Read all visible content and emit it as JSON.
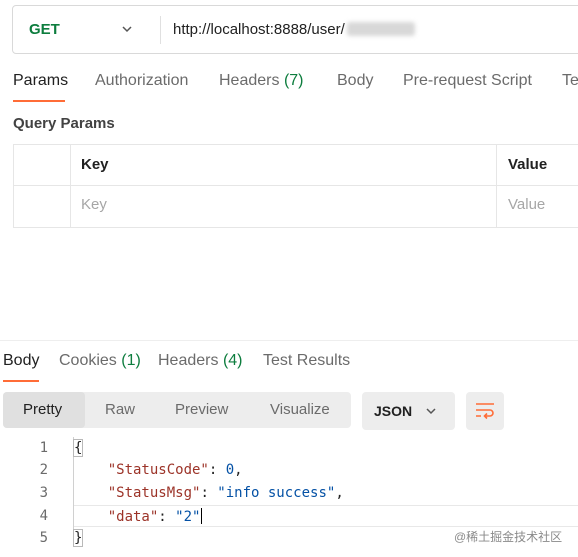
{
  "request": {
    "method": "GET",
    "url": "http://localhost:8888/user/"
  },
  "request_tabs": [
    {
      "label": "Params",
      "count": ""
    },
    {
      "label": "Authorization",
      "count": ""
    },
    {
      "label": "Headers",
      "count": "(7)"
    },
    {
      "label": "Body",
      "count": ""
    },
    {
      "label": "Pre-request Script",
      "count": ""
    },
    {
      "label": "Te",
      "count": ""
    }
  ],
  "query_params": {
    "title": "Query Params",
    "headers": {
      "key": "Key",
      "value": "Value"
    },
    "placeholders": {
      "key": "Key",
      "value": "Value"
    }
  },
  "response_tabs": [
    {
      "label": "Body",
      "count": ""
    },
    {
      "label": "Cookies",
      "count": "(1)"
    },
    {
      "label": "Headers",
      "count": "(4)"
    },
    {
      "label": "Test Results",
      "count": ""
    }
  ],
  "view_modes": [
    "Pretty",
    "Raw",
    "Preview",
    "Visualize"
  ],
  "format": "JSON",
  "code": {
    "line_numbers": [
      "1",
      "2",
      "3",
      "4",
      "5"
    ],
    "open": "{",
    "close": "}",
    "entries": [
      {
        "key": "\"StatusCode\"",
        "value": "0",
        "trail": ","
      },
      {
        "key": "\"StatusMsg\"",
        "value": "\"info success\"",
        "trail": ","
      },
      {
        "key": "\"data\"",
        "value": "\"2\"",
        "trail": ""
      }
    ]
  },
  "watermark": "@稀土掘金技术社区",
  "colors": {
    "accent": "#ff6c37",
    "method": "#0d7d3e",
    "json_key": "#9c3328",
    "json_value": "#0451a5"
  }
}
